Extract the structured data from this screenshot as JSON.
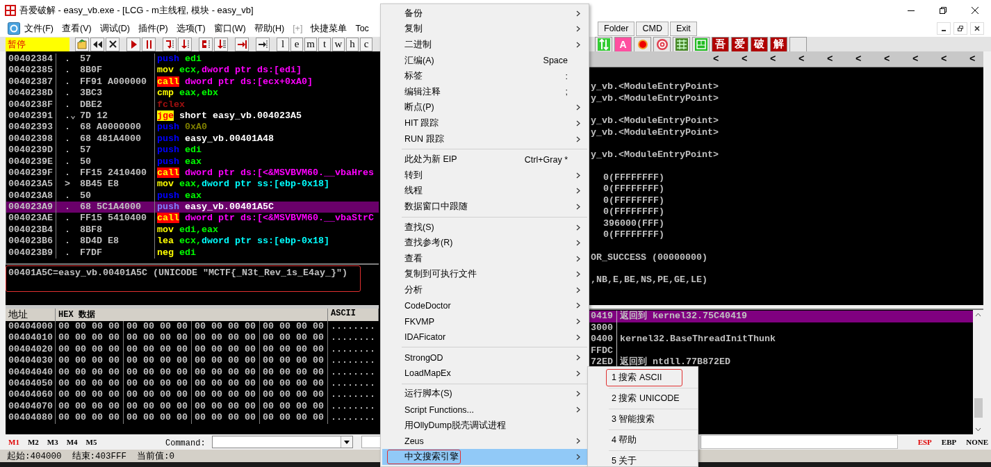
{
  "title_bar": {
    "title": "吾爱破解 - easy_vb.exe - [LCG - m主线程, 模块 - easy_vb]"
  },
  "menu_bar": {
    "items": [
      {
        "label": "文件(F)",
        "disabled": false
      },
      {
        "label": "查看(V)",
        "disabled": false
      },
      {
        "label": "调试(D)",
        "disabled": false
      },
      {
        "label": "插件(P)",
        "disabled": false
      },
      {
        "label": "选项(T)",
        "disabled": false
      },
      {
        "label": "窗口(W)",
        "disabled": false
      },
      {
        "label": "帮助(H)",
        "disabled": false
      },
      {
        "label": "[+]",
        "disabled": true
      },
      {
        "label": "快捷菜单",
        "disabled": false
      },
      {
        "label": "Toc",
        "disabled": false
      }
    ],
    "quick_buttons": [
      "Folder",
      "CMD",
      "Exit"
    ]
  },
  "toolbar": {
    "status": "暂停",
    "letter_buttons": [
      "l",
      "e",
      "m",
      "t",
      "w",
      "h",
      "c"
    ],
    "plugin_letter": "A",
    "brand_buttons": [
      "吾",
      "爱",
      "破",
      "解"
    ]
  },
  "disassembly": {
    "rows": [
      {
        "address": "00402384",
        "marker": ".",
        "hex": "57",
        "selected": false,
        "instruction": [
          {
            "text": "push",
            "kind": "push"
          },
          {
            "text": " edi",
            "kind": "register"
          }
        ]
      },
      {
        "address": "00402385",
        "marker": ".",
        "hex": "8B0F",
        "selected": false,
        "instruction": [
          {
            "text": "mov",
            "kind": "mnemonic"
          },
          {
            "text": " ecx,",
            "kind": "register"
          },
          {
            "text": "dword ptr ds:[edi]",
            "kind": "memory"
          }
        ]
      },
      {
        "address": "00402387",
        "marker": ".",
        "hex": "FF91 A000000",
        "selected": false,
        "instruction": [
          {
            "text": "call",
            "kind": "call"
          },
          {
            "text": " dword ptr ds:[ecx+0xA0]",
            "kind": "memory"
          }
        ]
      },
      {
        "address": "0040238D",
        "marker": ".",
        "hex": "3BC3",
        "selected": false,
        "instruction": [
          {
            "text": "cmp",
            "kind": "mnemonic"
          },
          {
            "text": " eax,ebx",
            "kind": "register"
          }
        ]
      },
      {
        "address": "0040238F",
        "marker": ".",
        "hex": "DBE2",
        "selected": false,
        "instruction": [
          {
            "text": "fclex",
            "kind": "fpu"
          }
        ]
      },
      {
        "address": "00402391",
        "marker": ".⌄",
        "hex": "7D 12",
        "selected": false,
        "instruction": [
          {
            "text": "jge",
            "kind": "jump"
          },
          {
            "text": " short easy_vb.004023A5",
            "kind": "label"
          }
        ]
      },
      {
        "address": "00402393",
        "marker": ".",
        "hex": "68 A0000000",
        "selected": false,
        "instruction": [
          {
            "text": "push",
            "kind": "push"
          },
          {
            "text": " 0xA0",
            "kind": "constant"
          }
        ]
      },
      {
        "address": "00402398",
        "marker": ".",
        "hex": "68 481A4000",
        "selected": false,
        "instruction": [
          {
            "text": "push",
            "kind": "push"
          },
          {
            "text": " easy_vb.00401A48",
            "kind": "label"
          }
        ]
      },
      {
        "address": "0040239D",
        "marker": ".",
        "hex": "57",
        "selected": false,
        "instruction": [
          {
            "text": "push",
            "kind": "push"
          },
          {
            "text": " edi",
            "kind": "register"
          }
        ]
      },
      {
        "address": "0040239E",
        "marker": ".",
        "hex": "50",
        "selected": false,
        "instruction": [
          {
            "text": "push",
            "kind": "push"
          },
          {
            "text": " eax",
            "kind": "register"
          }
        ]
      },
      {
        "address": "0040239F",
        "marker": ".",
        "hex": "FF15 2410400",
        "selected": false,
        "instruction": [
          {
            "text": "call",
            "kind": "call"
          },
          {
            "text": " dword ptr ds:[<&MSVBVM60.__vbaHres",
            "kind": "memory"
          }
        ]
      },
      {
        "address": "004023A5",
        "marker": ">",
        "hex": "8B45 E8",
        "selected": false,
        "instruction": [
          {
            "text": "mov",
            "kind": "mnemonic"
          },
          {
            "text": " eax,",
            "kind": "register"
          },
          {
            "text": "dword ptr ss:[ebp-0x18]",
            "kind": "stack"
          }
        ]
      },
      {
        "address": "004023A8",
        "marker": ".",
        "hex": "50",
        "selected": false,
        "instruction": [
          {
            "text": "push",
            "kind": "push"
          },
          {
            "text": " eax",
            "kind": "register"
          }
        ]
      },
      {
        "address": "004023A9",
        "marker": ".",
        "hex": "68 5C1A4000",
        "selected": true,
        "instruction": [
          {
            "text": "push",
            "kind": "push"
          },
          {
            "text": " easy_vb.00401A5C",
            "kind": "label"
          }
        ]
      },
      {
        "address": "004023AE",
        "marker": ".",
        "hex": "FF15 5410400",
        "selected": false,
        "instruction": [
          {
            "text": "call",
            "kind": "call"
          },
          {
            "text": " dword ptr ds:[<&MSVBVM60.__vbaStrC",
            "kind": "memory"
          }
        ]
      },
      {
        "address": "004023B4",
        "marker": ".",
        "hex": "8BF8",
        "selected": false,
        "instruction": [
          {
            "text": "mov",
            "kind": "mnemonic"
          },
          {
            "text": " edi,eax",
            "kind": "register"
          }
        ]
      },
      {
        "address": "004023B6",
        "marker": ".",
        "hex": "8D4D E8",
        "selected": false,
        "instruction": [
          {
            "text": "lea",
            "kind": "mnemonic"
          },
          {
            "text": " ecx,",
            "kind": "register"
          },
          {
            "text": "dword ptr ss:[ebp-0x18]",
            "kind": "stack"
          }
        ]
      },
      {
        "address": "004023B9",
        "marker": ".",
        "hex": "F7DF",
        "selected": false,
        "instruction": [
          {
            "text": "neg",
            "kind": "mnemonic"
          },
          {
            "text": " edi",
            "kind": "register"
          }
        ]
      }
    ]
  },
  "info": {
    "text": "00401A5C=easy_vb.00401A5C (UNICODE \"MCTF{_N3t_Rev_1s_E4ay_}\")",
    "annotated": true
  },
  "hex_dump": {
    "columns": [
      "地址",
      "HEX 数据",
      "ASCII"
    ],
    "rows": [
      {
        "address": "00404000",
        "groups": [
          "00 00 00 00",
          "00 00 00 00",
          "00 00 00 00",
          "00 00 00 00"
        ],
        "ascii": "........"
      },
      {
        "address": "00404010",
        "groups": [
          "00 00 00 00",
          "00 00 00 00",
          "00 00 00 00",
          "00 00 00 00"
        ],
        "ascii": "........"
      },
      {
        "address": "00404020",
        "groups": [
          "00 00 00 00",
          "00 00 00 00",
          "00 00 00 00",
          "00 00 00 00"
        ],
        "ascii": "........"
      },
      {
        "address": "00404030",
        "groups": [
          "00 00 00 00",
          "00 00 00 00",
          "00 00 00 00",
          "00 00 00 00"
        ],
        "ascii": "........"
      },
      {
        "address": "00404040",
        "groups": [
          "00 00 00 00",
          "00 00 00 00",
          "00 00 00 00",
          "00 00 00 00"
        ],
        "ascii": "........"
      },
      {
        "address": "00404050",
        "groups": [
          "00 00 00 00",
          "00 00 00 00",
          "00 00 00 00",
          "00 00 00 00"
        ],
        "ascii": "........"
      },
      {
        "address": "00404060",
        "groups": [
          "00 00 00 00",
          "00 00 00 00",
          "00 00 00 00",
          "00 00 00 00"
        ],
        "ascii": "........"
      },
      {
        "address": "00404070",
        "groups": [
          "00 00 00 00",
          "00 00 00 00",
          "00 00 00 00",
          "00 00 00 00"
        ],
        "ascii": "........"
      },
      {
        "address": "00404080",
        "groups": [
          "00 00 00 00",
          "00 00 00 00",
          "00 00 00 00",
          "00 00 00 00"
        ],
        "ascii": "........"
      }
    ]
  },
  "registers": {
    "header_arrows": [
      "<",
      "<",
      "<",
      "<",
      "<",
      "<",
      "<",
      "<",
      "<",
      "<"
    ],
    "groups": [
      {
        "kind": "symbol",
        "lines": [
          "y_vb.<ModuleEntryPoint>",
          "y_vb.<ModuleEntryPoint>"
        ]
      },
      {
        "kind": "symbol",
        "lines": [
          "y_vb.<ModuleEntryPoint>",
          "y_vb.<ModuleEntryPoint>"
        ]
      },
      {
        "kind": "symbol",
        "lines": [
          "y_vb.<ModuleEntryPoint>"
        ]
      },
      {
        "kind": "value",
        "lines": [
          "0(FFFFFFFF)",
          "0(FFFFFFFF)",
          "0(FFFFFFFF)",
          "0(FFFFFFFF)",
          "396000(FFF)",
          "0(FFFFFFFF)"
        ]
      },
      {
        "kind": "symbol",
        "lines": [
          "OR_SUCCESS (00000000)"
        ]
      },
      {
        "kind": "symbol",
        "lines": [
          ",NB,E,BE,NS,PE,GE,LE)"
        ]
      }
    ]
  },
  "stack": {
    "rows": [
      {
        "address": "0419",
        "comment": "返回到 kernel32.75C40419",
        "selected": true
      },
      {
        "address": "3000",
        "selected": false
      },
      {
        "address": "0400",
        "comment": "kernel32.BaseThreadInitThunk",
        "selected": false
      },
      {
        "address": "FFDC",
        "selected": false
      },
      {
        "address": "72ED",
        "comment": "返回到 ntdll.77B872ED",
        "selected": false
      }
    ]
  },
  "command_bar": {
    "memory_tabs": [
      {
        "label": "M1",
        "selected": true
      },
      {
        "label": "M2",
        "selected": false
      },
      {
        "label": "M3",
        "selected": false
      },
      {
        "label": "M4",
        "selected": false
      },
      {
        "label": "M5",
        "selected": false
      }
    ],
    "command_label": "Command:",
    "stack_modes": [
      {
        "label": "ESP",
        "selected": true
      },
      {
        "label": "EBP",
        "selected": false
      },
      {
        "label": "NONE",
        "selected": false
      }
    ]
  },
  "status_bar": {
    "text": "起始:404000  结束:403FFF  当前值:0"
  },
  "context_menu": {
    "groups": [
      [
        {
          "label": "备份",
          "submenu": true,
          "selected": false,
          "annotated": false
        },
        {
          "label": "复制",
          "submenu": true,
          "selected": false,
          "annotated": false
        },
        {
          "label": "二进制",
          "submenu": true,
          "selected": false,
          "annotated": false
        },
        {
          "label": "汇编(A)",
          "shortcut": "Space",
          "submenu": false,
          "selected": false,
          "annotated": false
        },
        {
          "label": "标签",
          "shortcut": ":",
          "submenu": false,
          "selected": false,
          "annotated": false
        },
        {
          "label": "编辑注释",
          "shortcut": ";",
          "submenu": false,
          "selected": false,
          "annotated": false
        },
        {
          "label": "断点(P)",
          "submenu": true,
          "selected": false,
          "annotated": false
        },
        {
          "label": "HIT 跟踪",
          "submenu": true,
          "selected": false,
          "annotated": false
        },
        {
          "label": "RUN 跟踪",
          "submenu": true,
          "selected": false,
          "annotated": false
        }
      ],
      [
        {
          "label": "此处为新 EIP",
          "shortcut": "Ctrl+Gray *",
          "submenu": false,
          "selected": false,
          "annotated": false
        },
        {
          "label": "转到",
          "submenu": true,
          "selected": false,
          "annotated": false
        },
        {
          "label": "线程",
          "submenu": true,
          "selected": false,
          "annotated": false
        },
        {
          "label": "数据窗口中跟随",
          "submenu": true,
          "selected": false,
          "annotated": false
        }
      ],
      [
        {
          "label": "查找(S)",
          "submenu": true,
          "selected": false,
          "annotated": false
        },
        {
          "label": "查找参考(R)",
          "submenu": true,
          "selected": false,
          "annotated": false
        },
        {
          "label": "查看",
          "submenu": true,
          "selected": false,
          "annotated": false
        },
        {
          "label": "复制到可执行文件",
          "submenu": true,
          "selected": false,
          "annotated": false
        },
        {
          "label": "分析",
          "submenu": true,
          "selected": false,
          "annotated": false
        },
        {
          "label": "CodeDoctor",
          "submenu": true,
          "selected": false,
          "annotated": false
        },
        {
          "label": "FKVMP",
          "submenu": true,
          "selected": false,
          "annotated": false
        },
        {
          "label": "IDAFicator",
          "submenu": true,
          "selected": false,
          "annotated": false
        }
      ],
      [
        {
          "label": "StrongOD",
          "submenu": true,
          "selected": false,
          "annotated": false
        },
        {
          "label": "LoadMapEx",
          "submenu": true,
          "selected": false,
          "annotated": false
        }
      ],
      [
        {
          "label": "运行脚本(S)",
          "submenu": true,
          "selected": false,
          "annotated": false
        },
        {
          "label": "Script Functions...",
          "submenu": true,
          "selected": false,
          "annotated": false
        },
        {
          "label": "用OllyDump脱壳调试进程",
          "submenu": false,
          "selected": false,
          "annotated": false
        },
        {
          "label": "Zeus",
          "submenu": true,
          "selected": false,
          "annotated": false
        },
        {
          "label": "中文搜索引擎",
          "submenu": true,
          "selected": true,
          "annotated": true
        }
      ]
    ]
  },
  "submenu": {
    "items": [
      {
        "label": "1 搜索 ASCII",
        "annotated": true
      },
      {
        "label": "2 搜索 UNICODE",
        "annotated": false
      },
      {
        "label": "3 智能搜索",
        "annotated": false
      },
      {
        "label": "4 帮助",
        "annotated": false
      },
      {
        "label": "5 关于",
        "annotated": false
      }
    ]
  }
}
